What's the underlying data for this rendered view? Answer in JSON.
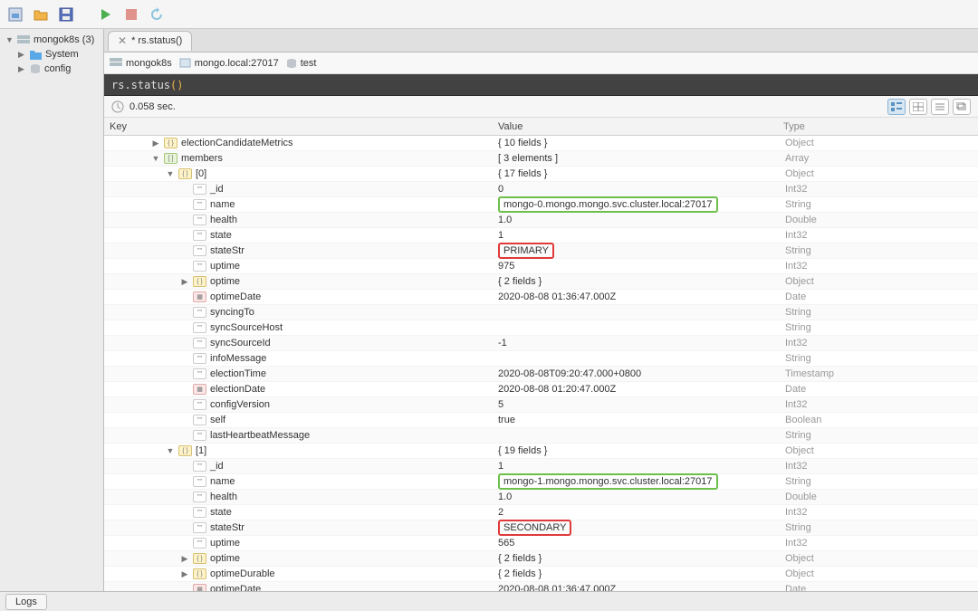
{
  "toolbar": {},
  "sidebar": {
    "root": "mongok8s (3)",
    "items": [
      "System",
      "config"
    ]
  },
  "tab": {
    "title": "* rs.status()"
  },
  "breadcrumb": {
    "server": "mongok8s",
    "host": "mongo.local:27017",
    "db": "test"
  },
  "command": {
    "prefix": "rs.status",
    "paren": "()"
  },
  "status": {
    "time": "0.058 sec."
  },
  "columns": {
    "key": "Key",
    "value": "Value",
    "type": "Type"
  },
  "rows": [
    {
      "depth": 2,
      "exp": "▶",
      "icon": "obj",
      "key": "electionCandidateMetrics",
      "value": "{ 10 fields }",
      "type": "Object"
    },
    {
      "depth": 2,
      "exp": "▼",
      "icon": "arr",
      "key": "members",
      "value": "[ 3 elements ]",
      "type": "Array"
    },
    {
      "depth": 3,
      "exp": "▼",
      "icon": "obj",
      "key": "[0]",
      "value": "{ 17 fields }",
      "type": "Object"
    },
    {
      "depth": 4,
      "exp": "",
      "icon": "str",
      "key": "_id",
      "value": "0",
      "type": "Int32"
    },
    {
      "depth": 4,
      "exp": "",
      "icon": "str",
      "key": "name",
      "value": "mongo-0.mongo.mongo.svc.cluster.local:27017",
      "hl": "green",
      "type": "String"
    },
    {
      "depth": 4,
      "exp": "",
      "icon": "str",
      "key": "health",
      "value": "1.0",
      "type": "Double"
    },
    {
      "depth": 4,
      "exp": "",
      "icon": "str",
      "key": "state",
      "value": "1",
      "type": "Int32"
    },
    {
      "depth": 4,
      "exp": "",
      "icon": "str",
      "key": "stateStr",
      "value": "PRIMARY",
      "hl": "red",
      "type": "String"
    },
    {
      "depth": 4,
      "exp": "",
      "icon": "str",
      "key": "uptime",
      "value": "975",
      "type": "Int32"
    },
    {
      "depth": 4,
      "exp": "▶",
      "icon": "obj",
      "key": "optime",
      "value": "{ 2 fields }",
      "type": "Object"
    },
    {
      "depth": 4,
      "exp": "",
      "icon": "date",
      "key": "optimeDate",
      "value": "2020-08-08 01:36:47.000Z",
      "type": "Date"
    },
    {
      "depth": 4,
      "exp": "",
      "icon": "str",
      "key": "syncingTo",
      "value": "",
      "type": "String"
    },
    {
      "depth": 4,
      "exp": "",
      "icon": "str",
      "key": "syncSourceHost",
      "value": "",
      "type": "String"
    },
    {
      "depth": 4,
      "exp": "",
      "icon": "str",
      "key": "syncSourceId",
      "value": "-1",
      "type": "Int32"
    },
    {
      "depth": 4,
      "exp": "",
      "icon": "str",
      "key": "infoMessage",
      "value": "",
      "type": "String"
    },
    {
      "depth": 4,
      "exp": "",
      "icon": "str",
      "key": "electionTime",
      "value": "2020-08-08T09:20:47.000+0800",
      "type": "Timestamp"
    },
    {
      "depth": 4,
      "exp": "",
      "icon": "date",
      "key": "electionDate",
      "value": "2020-08-08 01:20:47.000Z",
      "type": "Date"
    },
    {
      "depth": 4,
      "exp": "",
      "icon": "str",
      "key": "configVersion",
      "value": "5",
      "type": "Int32"
    },
    {
      "depth": 4,
      "exp": "",
      "icon": "str",
      "key": "self",
      "value": "true",
      "type": "Boolean"
    },
    {
      "depth": 4,
      "exp": "",
      "icon": "str",
      "key": "lastHeartbeatMessage",
      "value": "",
      "type": "String"
    },
    {
      "depth": 3,
      "exp": "▼",
      "icon": "obj",
      "key": "[1]",
      "value": "{ 19 fields }",
      "type": "Object"
    },
    {
      "depth": 4,
      "exp": "",
      "icon": "str",
      "key": "_id",
      "value": "1",
      "type": "Int32"
    },
    {
      "depth": 4,
      "exp": "",
      "icon": "str",
      "key": "name",
      "value": "mongo-1.mongo.mongo.svc.cluster.local:27017",
      "hl": "green",
      "type": "String"
    },
    {
      "depth": 4,
      "exp": "",
      "icon": "str",
      "key": "health",
      "value": "1.0",
      "type": "Double"
    },
    {
      "depth": 4,
      "exp": "",
      "icon": "str",
      "key": "state",
      "value": "2",
      "type": "Int32"
    },
    {
      "depth": 4,
      "exp": "",
      "icon": "str",
      "key": "stateStr",
      "value": "SECONDARY",
      "hl": "red",
      "type": "String"
    },
    {
      "depth": 4,
      "exp": "",
      "icon": "str",
      "key": "uptime",
      "value": "565",
      "type": "Int32"
    },
    {
      "depth": 4,
      "exp": "▶",
      "icon": "obj",
      "key": "optime",
      "value": "{ 2 fields }",
      "type": "Object"
    },
    {
      "depth": 4,
      "exp": "▶",
      "icon": "obj",
      "key": "optimeDurable",
      "value": "{ 2 fields }",
      "type": "Object"
    },
    {
      "depth": 4,
      "exp": "",
      "icon": "date",
      "key": "optimeDate",
      "value": "2020-08-08 01:36:47.000Z",
      "type": "Date"
    }
  ],
  "bottom": {
    "logs": "Logs"
  }
}
